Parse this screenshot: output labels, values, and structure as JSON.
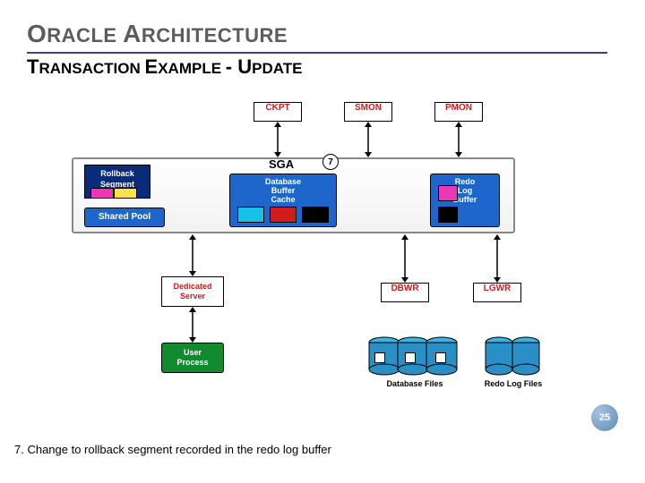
{
  "slide": {
    "title_word1": "RACLE ",
    "title_word1_cap": "O",
    "title_word2_cap": "A",
    "title_word2": "RCHITECTURE",
    "subtitle_w1_cap": "T",
    "subtitle_w1": "RANSACTION ",
    "subtitle_w2_cap": "E",
    "subtitle_w2": "XAMPLE ",
    "subtitle_dash": "- ",
    "subtitle_w3_cap": "U",
    "subtitle_w3": "PDATE"
  },
  "procs": {
    "ckpt": "CKPT",
    "smon": "SMON",
    "pmon": "PMON",
    "dbwr": "DBWR",
    "lgwr": "LGWR"
  },
  "sga_label": "SGA",
  "rollback": {
    "line1": "Rollback",
    "line2": "Segment"
  },
  "shared_pool": "Shared Pool",
  "db_cache": {
    "l1": "Database",
    "l2": "Buffer",
    "l3": "Cache"
  },
  "redo_buf": {
    "l1": "Redo",
    "l2": "Log",
    "l3": "Buffer"
  },
  "dedicated": {
    "l1": "Dedicated",
    "l2": "Server"
  },
  "user_proc": {
    "l1": "User",
    "l2": "Process"
  },
  "files": {
    "db": "Database Files",
    "redo": "Redo Log Files"
  },
  "step_num": "7",
  "page_num": "25",
  "footer": "7. Change to rollback segment recorded in the redo log buffer",
  "colors": {
    "proc_red": "#d11c1c",
    "cyan": "#16c0e7",
    "magenta": "#eb38b6",
    "black": "#000",
    "navy": "#0a2a7a",
    "blue_box": "#1f66cc",
    "sgaTop": "#fafafa",
    "sgaBot": "#e8e8e8",
    "gold": "#fbe14a",
    "green": "#128a2e"
  }
}
